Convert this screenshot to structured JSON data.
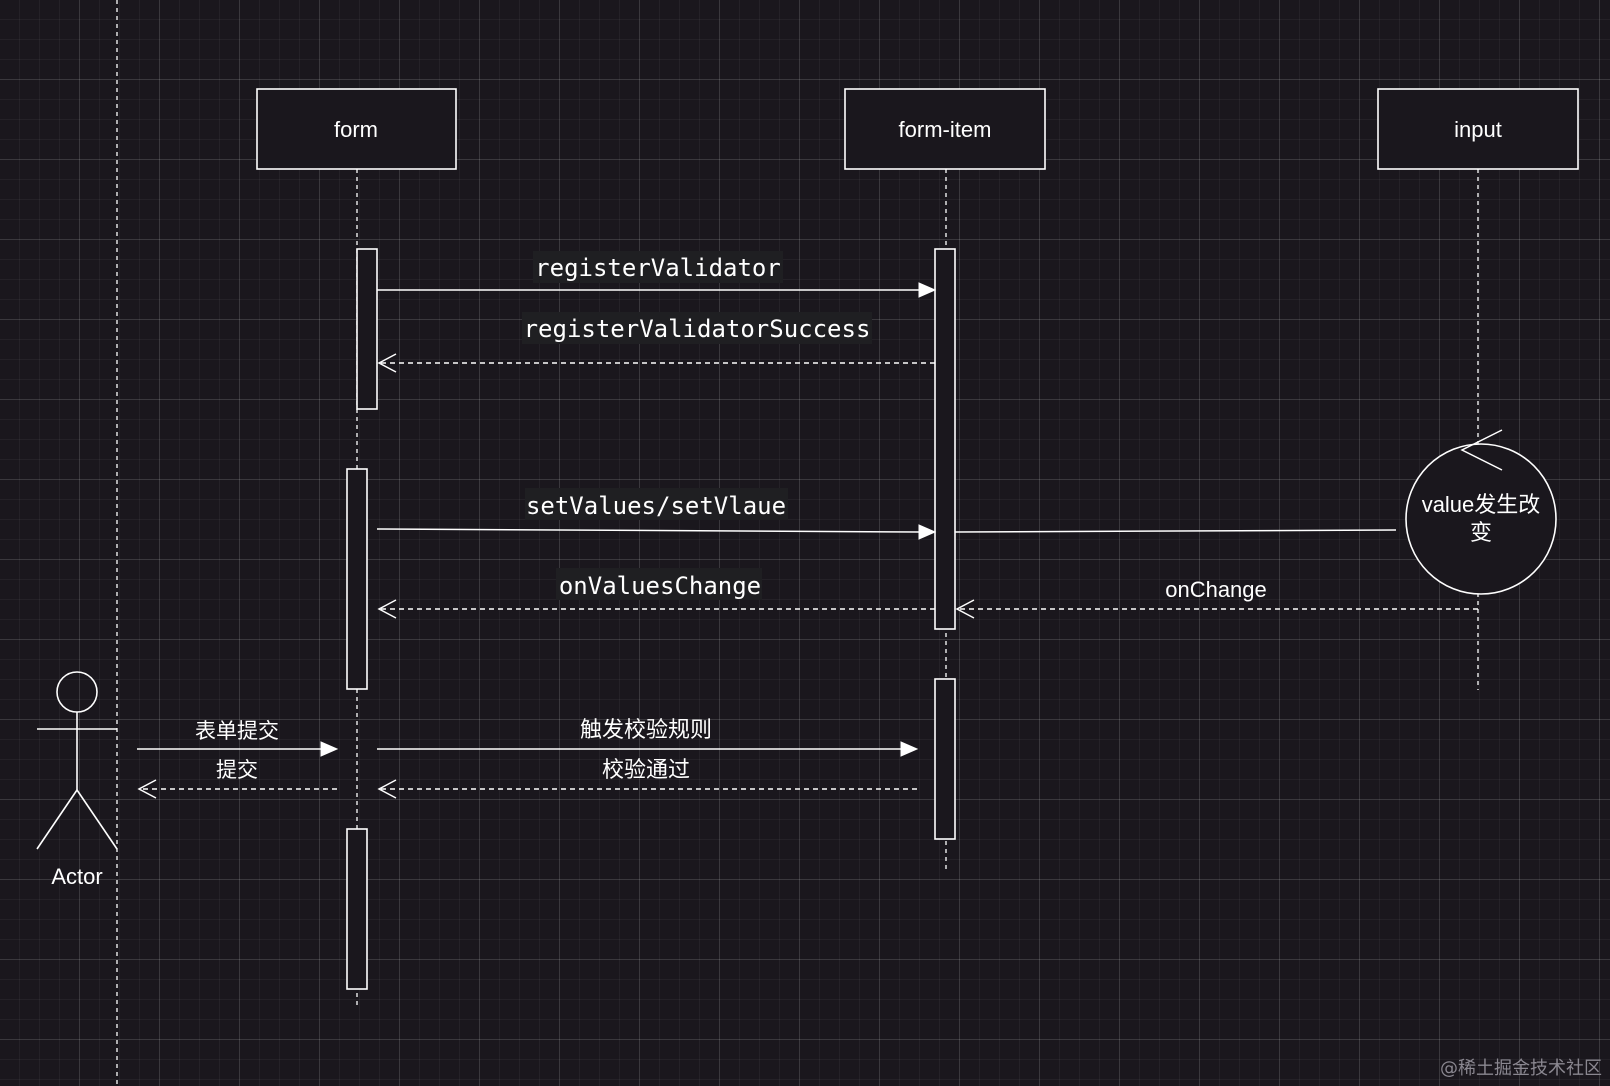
{
  "participants": {
    "form": "form",
    "form_item": "form-item",
    "input": "input"
  },
  "actor": {
    "label": "Actor"
  },
  "messages": {
    "register_validator": "registerValidator",
    "register_validator_success": "registerValidatorSuccess",
    "set_values": "setValues/setVlaue",
    "on_values_change": "onValuesChange",
    "on_change": "onChange",
    "form_submit": "表单提交",
    "submit": "提交",
    "trigger_validation": "触发校验规则",
    "validation_passed": "校验通过"
  },
  "event": {
    "line1": "value发生改",
    "line2": "变"
  },
  "watermark": "@稀土掘金技术社区",
  "colors": {
    "background": "#1a171d",
    "stroke": "#ffffff"
  }
}
